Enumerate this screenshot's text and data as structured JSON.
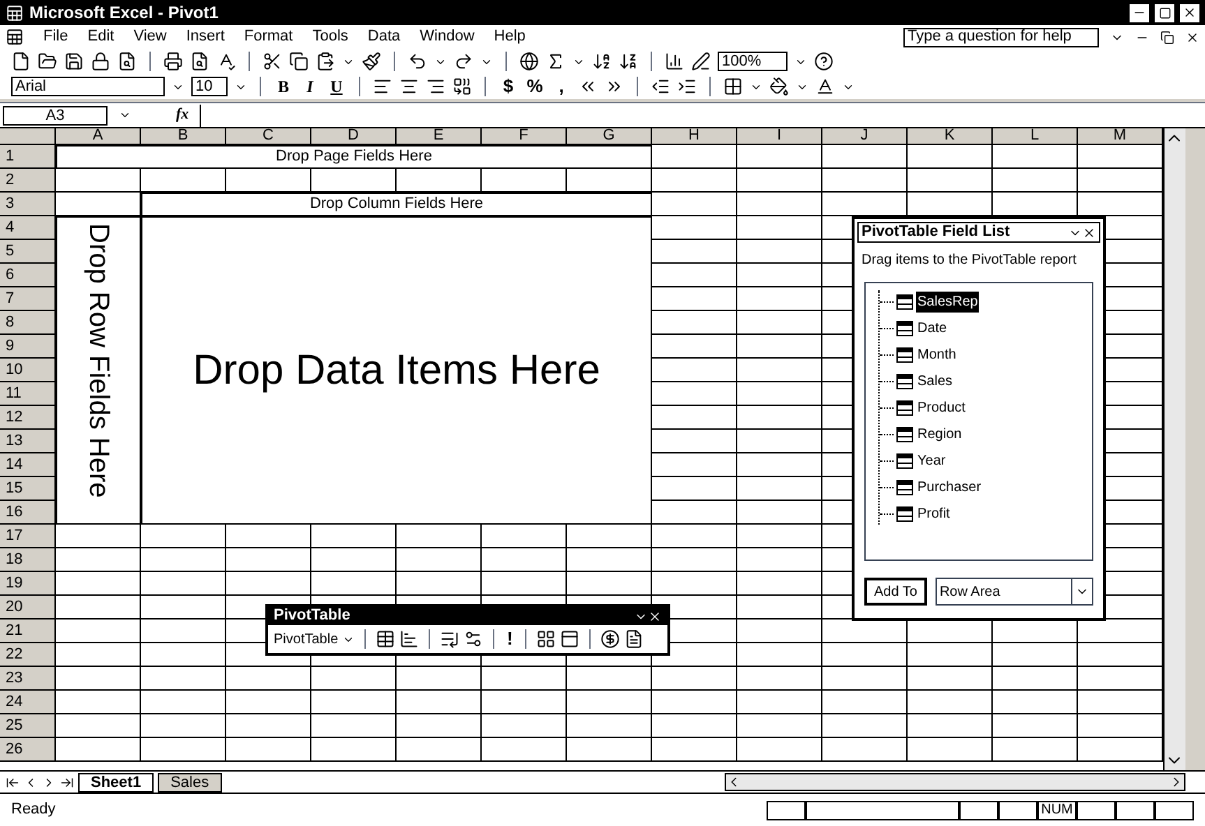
{
  "window": {
    "title": "Microsoft Excel - Pivot1"
  },
  "menu": [
    "File",
    "Edit",
    "View",
    "Insert",
    "Format",
    "Tools",
    "Data",
    "Window",
    "Help"
  ],
  "help_box": {
    "placeholder": "Type a question for help"
  },
  "zoom": "100%",
  "font": {
    "name": "Arial",
    "size": "10"
  },
  "format_buttons": [
    "B",
    "I",
    "U"
  ],
  "number_buttons": [
    "$",
    "%",
    ","
  ],
  "name_box": "A3",
  "formula_icon": "fx",
  "columns": [
    "A",
    "B",
    "C",
    "D",
    "E",
    "F",
    "G",
    "H",
    "I",
    "J",
    "K",
    "L",
    "M"
  ],
  "rows": [
    "1",
    "2",
    "3",
    "4",
    "5",
    "6",
    "7",
    "8",
    "9",
    "10",
    "11",
    "12",
    "13",
    "14",
    "15",
    "16",
    "17",
    "18",
    "19",
    "20",
    "21",
    "22",
    "23",
    "24",
    "25",
    "26"
  ],
  "pivot": {
    "page": "Drop Page Fields Here",
    "column": "Drop Column Fields Here",
    "row": "Drop Row Fields Here",
    "data": "Drop Data Items Here"
  },
  "field_list": {
    "title": "PivotTable Field List",
    "hint": "Drag items to the PivotTable report",
    "fields": [
      {
        "label": "SalesRep",
        "selected": true
      },
      {
        "label": "Date",
        "selected": false
      },
      {
        "label": "Month",
        "selected": false
      },
      {
        "label": "Sales",
        "selected": false
      },
      {
        "label": "Product",
        "selected": false
      },
      {
        "label": "Region",
        "selected": false
      },
      {
        "label": "Year",
        "selected": false
      },
      {
        "label": "Purchaser",
        "selected": false
      },
      {
        "label": "Profit",
        "selected": false
      }
    ],
    "add_button": "Add To",
    "area": "Row Area"
  },
  "pivot_toolbar": {
    "title": "PivotTable",
    "menu": "PivotTable",
    "refresh": "!"
  },
  "sheet_tabs": [
    {
      "label": "Sheet1",
      "selected": true
    },
    {
      "label": "Sales",
      "selected": false
    }
  ],
  "status": {
    "text": "Ready",
    "indicators": [
      "NUM"
    ]
  }
}
